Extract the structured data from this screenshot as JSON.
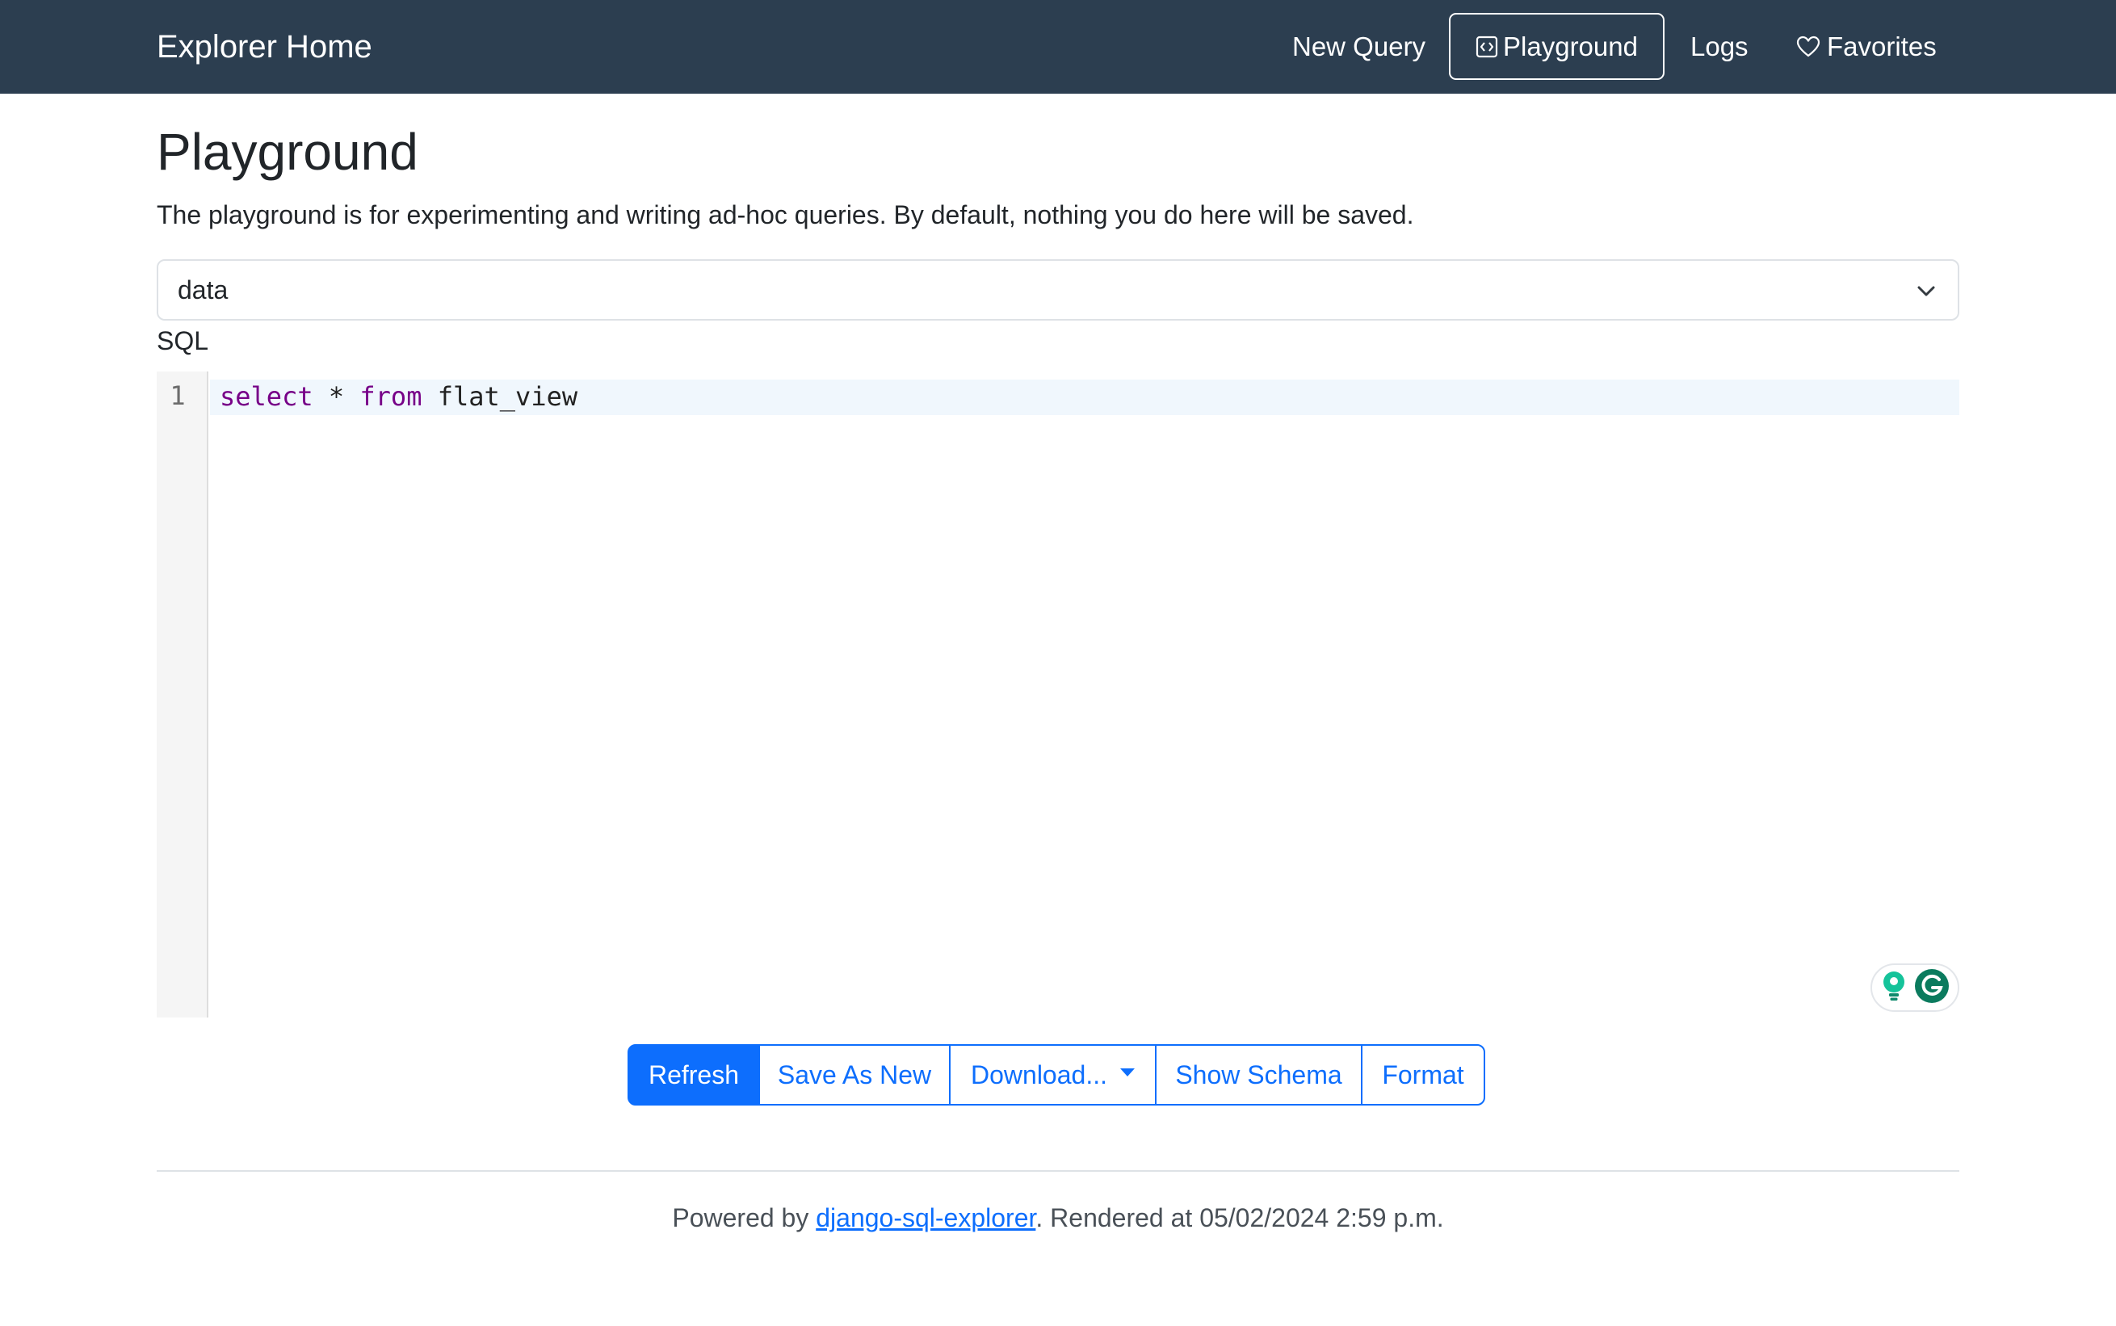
{
  "navbar": {
    "brand": "Explorer Home",
    "links": [
      {
        "label": "New Query",
        "icon": null,
        "active": false
      },
      {
        "label": "Playground",
        "icon": "code-icon",
        "active": true
      },
      {
        "label": "Logs",
        "icon": null,
        "active": false
      },
      {
        "label": "Favorites",
        "icon": "heart-icon",
        "active": false
      }
    ]
  },
  "page": {
    "title": "Playground",
    "description": "The playground is for experimenting and writing ad-hoc queries. By default, nothing you do here will be saved."
  },
  "connection_select": {
    "selected": "data",
    "icon": "chevron-down-icon"
  },
  "editor": {
    "label": "SQL",
    "lines": [
      {
        "number": "1",
        "tokens": [
          "select",
          " * ",
          "from",
          " flat_view"
        ]
      }
    ],
    "assistant_icons": [
      "lightbulb-icon",
      "grammarly-icon"
    ]
  },
  "actions": {
    "refresh": "Refresh",
    "save_as_new": "Save As New",
    "download": "Download...",
    "show_schema": "Show Schema",
    "format": "Format"
  },
  "footer": {
    "prefix": "Powered by ",
    "link_text": "django-sql-explorer",
    "suffix": ". Rendered at 05/02/2024 2:59 p.m."
  },
  "colors": {
    "navbar_bg": "#2c3e50",
    "primary": "#0d6efd",
    "keyword": "#770088",
    "active_line": "#f0f7fd"
  }
}
